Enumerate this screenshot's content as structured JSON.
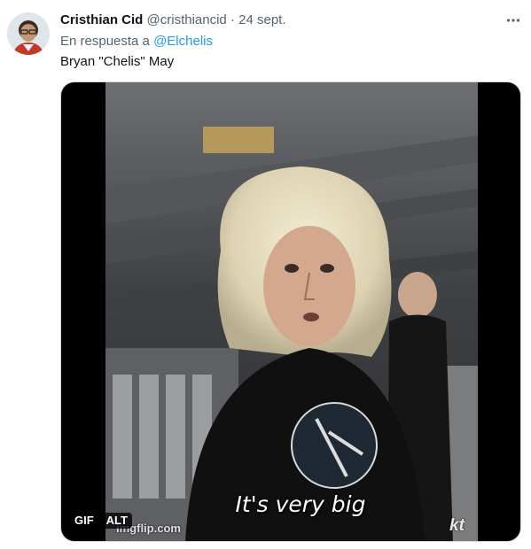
{
  "tweet": {
    "author_name": "Cristhian Cid",
    "author_handle": "@cristhiancid",
    "separator": "·",
    "time": "24 sept.",
    "reply_prefix": "En respuesta a",
    "reply_mention": "@Elchelis",
    "text": "Bryan \"Chelis\" May"
  },
  "media": {
    "caption": "It's very big",
    "watermark": "imgflip.com",
    "corner_logo": "kt",
    "gif_badge": "GIF",
    "alt_badge": "ALT"
  },
  "icons": {
    "more": "more-horizontal-icon",
    "avatar": "avatar"
  },
  "colors": {
    "primary_text": "#0f1419",
    "secondary_text": "#536471",
    "link": "#1d9bf0",
    "media_background": "#000000"
  }
}
